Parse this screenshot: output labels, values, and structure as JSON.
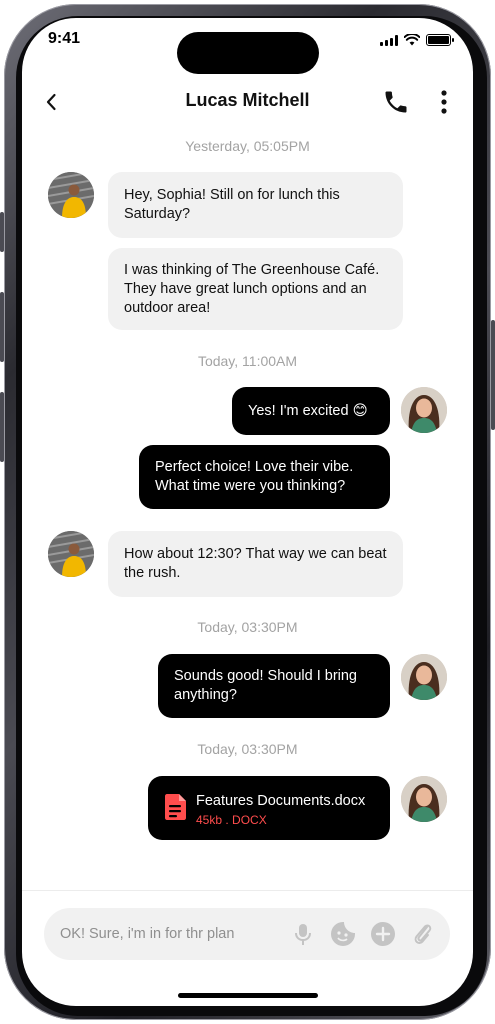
{
  "status_bar": {
    "time": "9:41"
  },
  "header": {
    "contact_name": "Lucas Mitchell"
  },
  "messages": [
    {
      "type": "timestamp",
      "text": "Yesterday, 05:05PM"
    },
    {
      "type": "incoming",
      "sender": "Lucas Mitchell",
      "text": "Hey, Sophia! Still on for lunch this Saturday?"
    },
    {
      "type": "incoming",
      "sender": "Lucas Mitchell",
      "text": "I was thinking of The Greenhouse Café. They have great lunch options and an outdoor area!"
    },
    {
      "type": "timestamp",
      "text": "Today, 11:00AM"
    },
    {
      "type": "outgoing",
      "sender": "Sophia",
      "text": "Yes! I'm excited 😊"
    },
    {
      "type": "outgoing",
      "sender": "Sophia",
      "text": "Perfect choice! Love their vibe. What time were you thinking?"
    },
    {
      "type": "incoming",
      "sender": "Lucas Mitchell",
      "text": "How about 12:30? That way we can beat the rush."
    },
    {
      "type": "timestamp",
      "text": "Today, 03:30PM"
    },
    {
      "type": "outgoing",
      "sender": "Sophia",
      "text": "Sounds good! Should I bring anything?"
    },
    {
      "type": "timestamp",
      "text": "Today, 03:30PM"
    },
    {
      "type": "file",
      "sender": "Sophia",
      "file_name": "Features Documents.docx",
      "file_meta": "45kb . DOCX"
    }
  ],
  "composer": {
    "placeholder": "OK! Sure, i'm in for thr plan",
    "buttons": [
      "mic-icon",
      "sticker-icon",
      "plus-icon",
      "attachment-icon"
    ]
  },
  "colors": {
    "outgoing_bubble": "#000000",
    "incoming_bubble": "#f1f1f1",
    "file_accent": "#ff4d4d",
    "timestamp": "#a3a3a3"
  }
}
